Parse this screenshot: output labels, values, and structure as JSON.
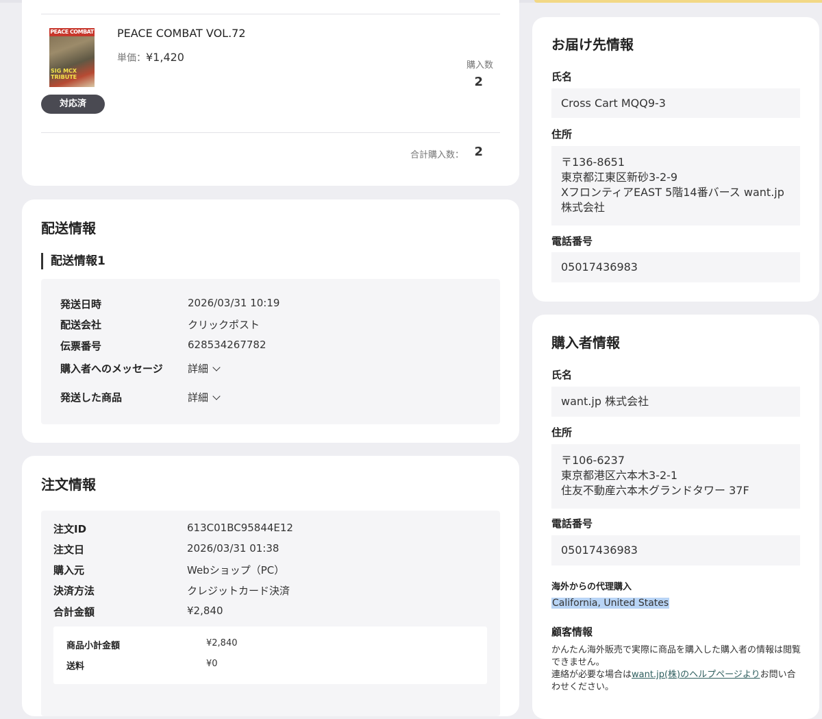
{
  "product": {
    "title": "PEACE COMBAT VOL.72",
    "thumb_masthead": "PEACE COMBAT",
    "thumb_subtitle": "SIG MCX TRIBUTE",
    "status_badge": "対応済",
    "unit_price_label": "単価：",
    "unit_price": "¥1,420",
    "quantity_label": "購入数",
    "quantity": "2",
    "total_quantity_label": "合計購入数：",
    "total_quantity": "2"
  },
  "shipping": {
    "title": "配送情報",
    "subtitle": "配送情報1",
    "rows": [
      {
        "label": "発送日時",
        "value": "2026/03/31 10:19"
      },
      {
        "label": "配送会社",
        "value": "クリックポスト"
      },
      {
        "label": "伝票番号",
        "value": "628534267782"
      }
    ],
    "message_label": "購入者へのメッセージ",
    "message_toggle": "詳細",
    "items_label": "発送した商品",
    "items_toggle": "詳細"
  },
  "order": {
    "title": "注文情報",
    "rows": [
      {
        "label": "注文ID",
        "value": "613C01BC95844E12"
      },
      {
        "label": "注文日",
        "value": "2026/03/31 01:38"
      },
      {
        "label": "購入元",
        "value": "Webショップ（PC）"
      },
      {
        "label": "決済方法",
        "value": "クレジットカード決済"
      },
      {
        "label": "合計金額",
        "value": "¥2,840"
      }
    ],
    "breakdown": [
      {
        "label": "商品小計金額",
        "value": "¥2,840"
      },
      {
        "label": "送料",
        "value": "¥0"
      }
    ]
  },
  "destination": {
    "title": "お届け先情報",
    "name_label": "氏名",
    "name": "Cross Cart MQQ9-3",
    "address_label": "住所",
    "address_lines": [
      "〒136-8651",
      "東京都江東区新砂3-2-9",
      "XフロンティアEAST 5階14番バース want.jp",
      "株式会社"
    ],
    "phone_label": "電話番号",
    "phone": "05017436983"
  },
  "buyer": {
    "title": "購入者情報",
    "name_label": "氏名",
    "name": "want.jp 株式会社",
    "address_label": "住所",
    "address_lines": [
      "〒106-6237",
      "東京都港区六本木3-2-1",
      "住友不動産六本木グランドタワー 37F"
    ],
    "phone_label": "電話番号",
    "phone": "05017436983",
    "proxy_label": "海外からの代理購入",
    "proxy_value": "California, United States",
    "customer_label": "顧客情報",
    "customer_note_1": "かんたん海外販売で実際に商品を購入した購入者の情報は閲覧できません。",
    "customer_note_2a": "連絡が必要な場合は",
    "customer_note_link": "want.jp(株)のヘルプページより",
    "customer_note_2b": "お問い合わせください。"
  },
  "colors": {
    "background": "#eeeef2",
    "card": "#ffffff",
    "panel": "#f5f5f7",
    "badge": "#4a4a52",
    "highlight": "#b8d4f5",
    "link": "#2e5e5e",
    "top_accent": "#f2d886"
  }
}
